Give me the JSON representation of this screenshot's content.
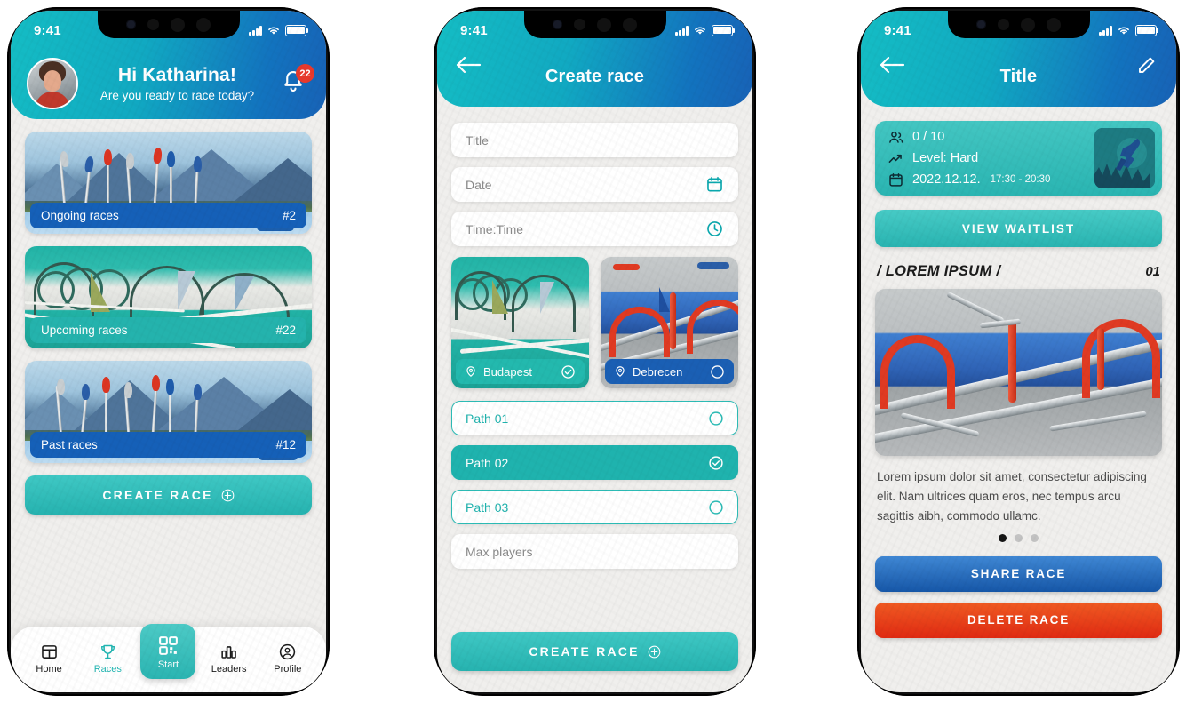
{
  "status_bar": {
    "time": "9:41",
    "signal_icon": "signal-bars-icon",
    "wifi_icon": "wifi-icon",
    "battery_icon": "battery-icon"
  },
  "screen_home": {
    "header": {
      "greeting": "Hi Katharina!",
      "subtitle": "Are you ready to race today?",
      "avatar_alt": "user-avatar",
      "notification_icon": "bell-icon",
      "notification_count": "22"
    },
    "cards": [
      {
        "label": "Ongoing races",
        "count": "#2",
        "bar_color": "#1560b8",
        "art": "mountain"
      },
      {
        "label": "Upcoming races",
        "count": "#22",
        "bar_color": "#24b3ad",
        "art": "course"
      },
      {
        "label": "Past races",
        "count": "#12",
        "bar_color": "#1560b8",
        "art": "mountain"
      }
    ],
    "create_button": {
      "label": "CREATE RACE",
      "icon": "plus-circle-icon"
    },
    "tabs": [
      {
        "label": "Home",
        "icon": "table-icon",
        "state": "default"
      },
      {
        "label": "Races",
        "icon": "trophy-icon",
        "state": "highlight"
      },
      {
        "label": "Start",
        "icon": "qr-code-icon",
        "state": "active"
      },
      {
        "label": "Leaders",
        "icon": "bar-chart-icon",
        "state": "default"
      },
      {
        "label": "Profile",
        "icon": "person-circle-icon",
        "state": "default"
      }
    ]
  },
  "screen_create": {
    "header": {
      "title": "Create race",
      "back_icon": "arrow-left-icon"
    },
    "fields": [
      {
        "placeholder": "Title",
        "icon": ""
      },
      {
        "placeholder": "Date",
        "icon": "calendar-icon"
      },
      {
        "placeholder": "Time:Time",
        "icon": "clock-icon"
      }
    ],
    "locations": [
      {
        "name": "Budapest",
        "selected": true,
        "pin_icon": "location-pin-icon",
        "check_icon": "check-circle-icon",
        "bar_color": "#23b9ae"
      },
      {
        "name": "Debrecen",
        "selected": false,
        "pin_icon": "location-pin-icon",
        "check_icon": "circle-icon",
        "bar_color": "#1a5fb4"
      }
    ],
    "paths": [
      {
        "label": "Path 01",
        "selected": false
      },
      {
        "label": "Path 02",
        "selected": true
      },
      {
        "label": "Path 03",
        "selected": false
      }
    ],
    "max_players_placeholder": "Max players",
    "submit_button": {
      "label": "CREATE RACE",
      "icon": "plus-circle-icon"
    }
  },
  "screen_detail": {
    "header": {
      "title": "Title",
      "back_icon": "arrow-left-icon",
      "edit_icon": "pencil-icon"
    },
    "info": {
      "players_icon": "people-icon",
      "players": "0 / 10",
      "level_icon": "trend-up-icon",
      "level": "Level: Hard",
      "date_icon": "calendar-icon",
      "date": "2022.12.12.",
      "time_range": "17:30 - 20:30",
      "thumbnail_alt": "race-thumbnail"
    },
    "waitlist_button": "VIEW WAITLIST",
    "section": {
      "title": "/ LOREM IPSUM /",
      "number": "01"
    },
    "gallery_alt": "race-photo",
    "description": "Lorem ipsum dolor sit amet, consectetur adipiscing elit. Nam ultrices quam eros, nec tempus arcu sagittis aibh, commodo ullamc.",
    "pager": {
      "total": 3,
      "active": 1
    },
    "share_button": "SHARE RACE",
    "delete_button": "DELETE RACE"
  },
  "theme": {
    "teal": "#2bb5b2",
    "blue": "#1560b8",
    "red": "#e02a12",
    "header_gradient_start": "#14bdc4",
    "header_gradient_end": "#1862b6",
    "page_bg": "#f0efed"
  }
}
